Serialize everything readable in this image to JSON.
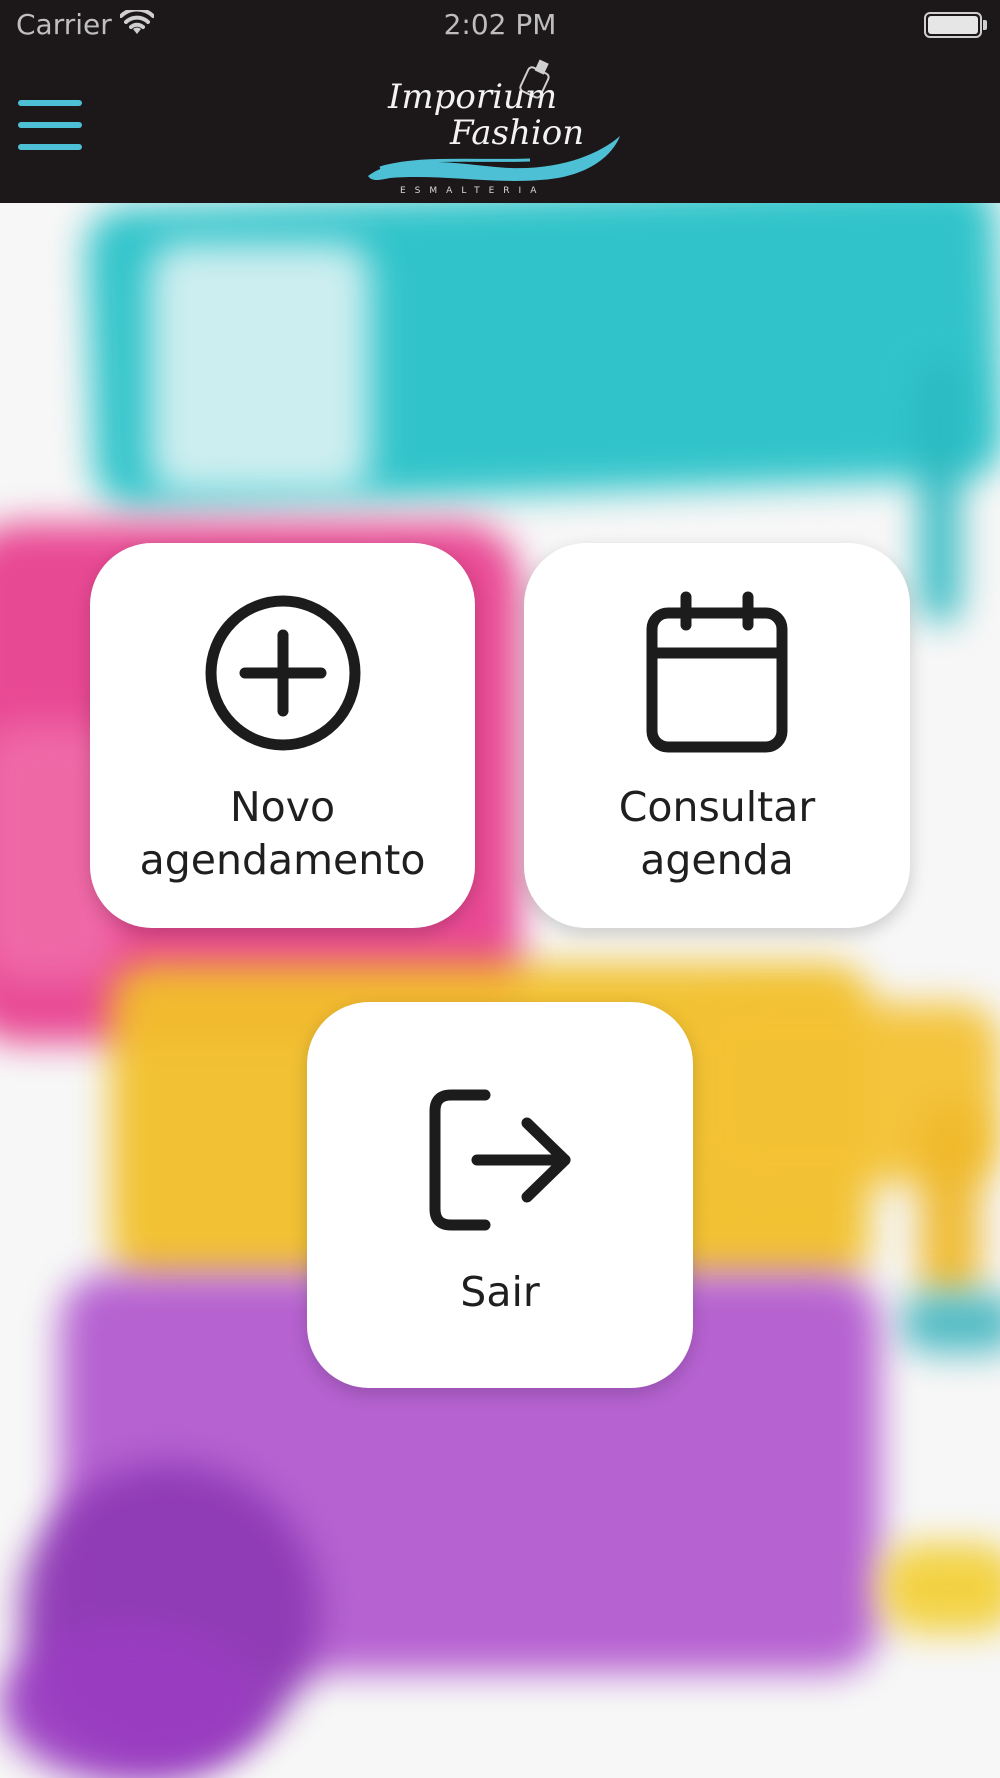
{
  "status_bar": {
    "carrier": "Carrier",
    "time": "2:02 PM"
  },
  "header": {
    "menu_icon": "hamburger-menu-icon",
    "logo": {
      "line1": "Imporium",
      "line2": "Fashion",
      "tagline": "ESMALTERIA"
    },
    "accent_color": "#4ec0d6",
    "background_color": "#1c1718"
  },
  "menu": {
    "new_appointment": {
      "line1": "Novo",
      "line2": "agendamento",
      "icon": "add-circle-icon"
    },
    "view_schedule": {
      "line1": "Consultar",
      "line2": "agenda",
      "icon": "calendar-icon"
    },
    "logout": {
      "label": "Sair",
      "icon": "logout-icon"
    }
  }
}
